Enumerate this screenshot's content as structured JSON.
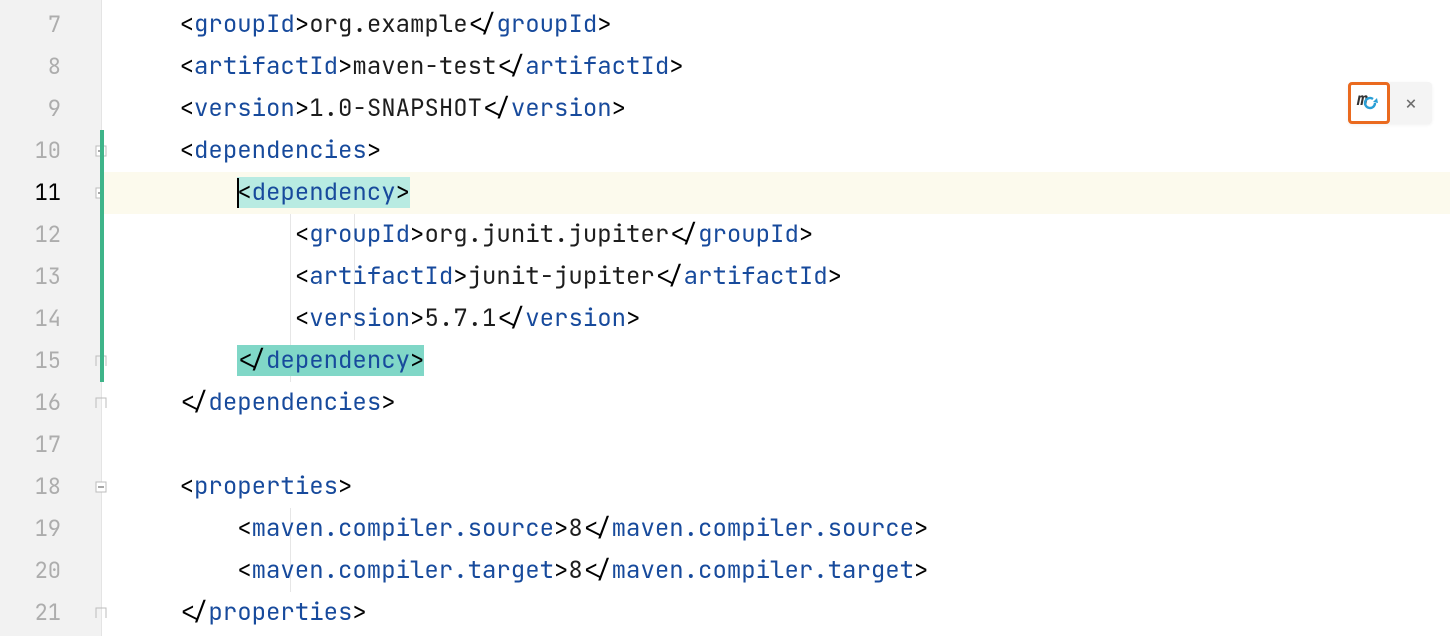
{
  "gutter": {
    "start": 7,
    "end": 21,
    "active_line": 11,
    "fold_markers": [
      {
        "line": 10,
        "kind": "open"
      },
      {
        "line": 11,
        "kind": "open"
      },
      {
        "line": 15,
        "kind": "close"
      },
      {
        "line": 16,
        "kind": "close"
      },
      {
        "line": 18,
        "kind": "open"
      },
      {
        "line": 21,
        "kind": "close"
      }
    ],
    "change_bar": {
      "from": 10,
      "to": 15
    }
  },
  "code": {
    "indent_unit": "    ",
    "lines": [
      {
        "n": 7,
        "indent": 1,
        "open": "groupId",
        "text": "org.example",
        "close": "groupId"
      },
      {
        "n": 8,
        "indent": 1,
        "open": "artifactId",
        "text": "maven-test",
        "close": "artifactId"
      },
      {
        "n": 9,
        "indent": 1,
        "open": "version",
        "text": "1.0-SNAPSHOT",
        "close": "version"
      },
      {
        "n": 10,
        "indent": 1,
        "open": "dependencies"
      },
      {
        "n": 11,
        "indent": 2,
        "open": "dependency",
        "highlight": "match_open",
        "current": true
      },
      {
        "n": 12,
        "indent": 3,
        "open": "groupId",
        "text": "org.junit.jupiter",
        "close": "groupId"
      },
      {
        "n": 13,
        "indent": 3,
        "open": "artifactId",
        "text": "junit-jupiter",
        "close": "artifactId"
      },
      {
        "n": 14,
        "indent": 3,
        "open": "version",
        "text": "5.7.1",
        "close": "version"
      },
      {
        "n": 15,
        "indent": 2,
        "close_only": "dependency",
        "highlight": "match_close"
      },
      {
        "n": 16,
        "indent": 1,
        "close_only": "dependencies"
      },
      {
        "n": 17,
        "indent": 0,
        "blank": true
      },
      {
        "n": 18,
        "indent": 1,
        "open": "properties"
      },
      {
        "n": 19,
        "indent": 2,
        "open": "maven.compiler.source",
        "text": "8",
        "close": "maven.compiler.source"
      },
      {
        "n": 20,
        "indent": 2,
        "open": "maven.compiler.target",
        "text": "8",
        "close": "maven.compiler.target"
      },
      {
        "n": 21,
        "indent": 1,
        "close_only": "properties"
      }
    ]
  },
  "floating": {
    "reload_label": "m",
    "close_label": "×"
  }
}
